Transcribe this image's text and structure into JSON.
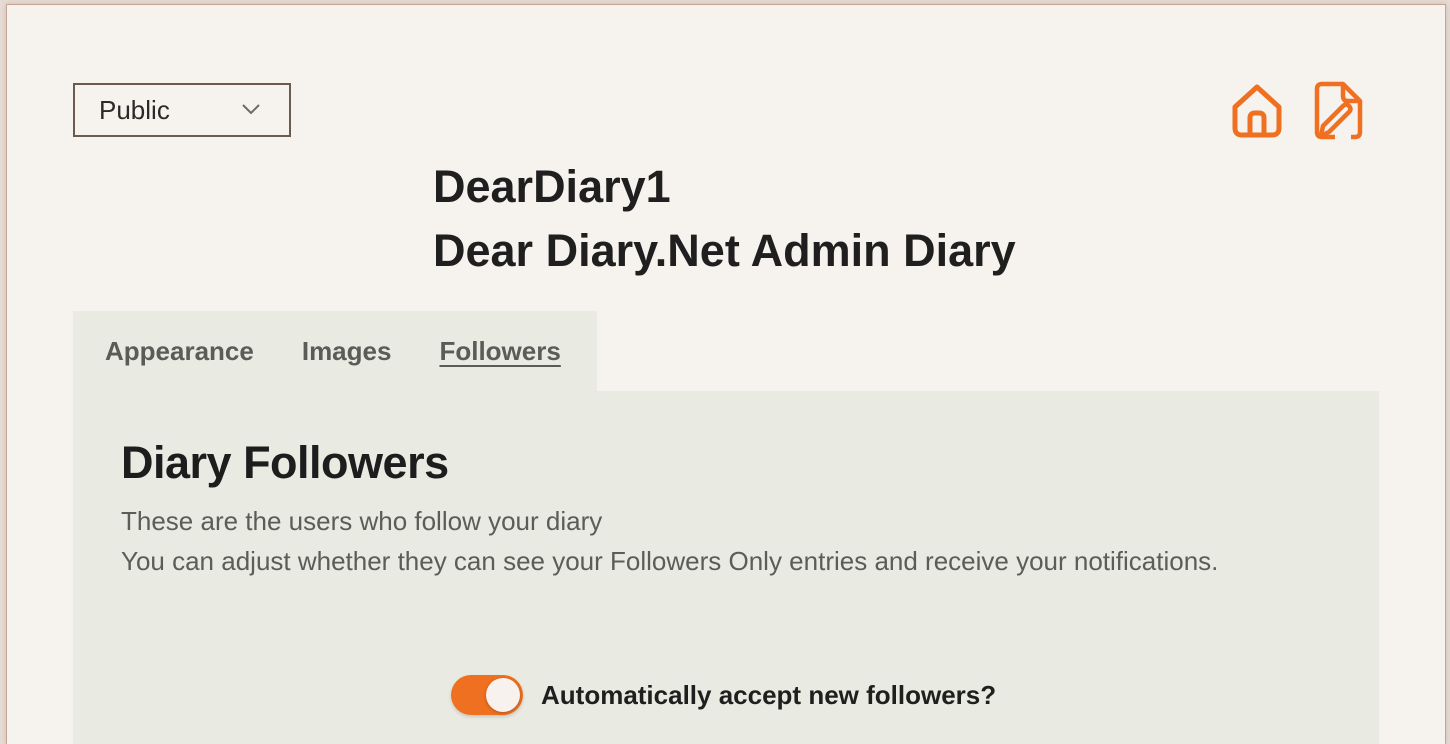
{
  "visibility": {
    "selected": "Public"
  },
  "colors": {
    "accent": "#ee7020",
    "page_bg": "#f6f2ed",
    "panel_bg": "#e9eae1"
  },
  "header_icons": [
    "home-icon",
    "edit-document-icon"
  ],
  "title": {
    "username": "DearDiary1",
    "diary_name": "Dear Diary.Net Admin Diary"
  },
  "tabs": [
    {
      "label": "Appearance",
      "active": false
    },
    {
      "label": "Images",
      "active": false
    },
    {
      "label": "Followers",
      "active": true
    }
  ],
  "followers_panel": {
    "heading": "Diary Followers",
    "desc_line1": "These are the users who follow your diary",
    "desc_line2": "You can adjust whether they can see your Followers Only entries and receive your notifications.",
    "auto_accept": {
      "label": "Automatically accept new followers?",
      "on": true
    }
  }
}
